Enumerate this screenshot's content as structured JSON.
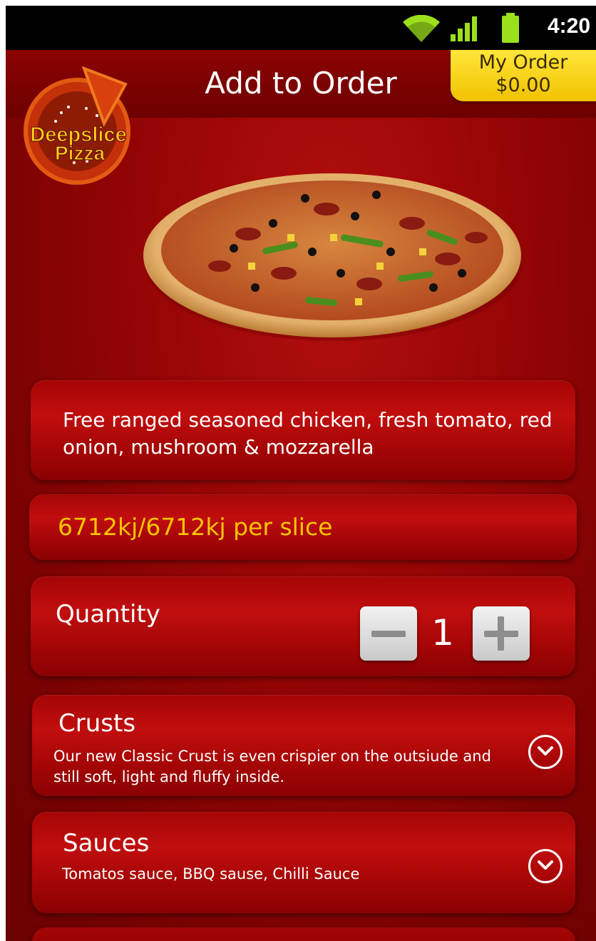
{
  "status_bar": {
    "time": "4:20",
    "icons": [
      "wifi-icon",
      "signal-icon",
      "battery-icon"
    ]
  },
  "header": {
    "title": "Add to Order",
    "my_order_label": "My Order",
    "my_order_total": "$0.00"
  },
  "logo": {
    "line1": "Deepslice",
    "line2": "Pizza"
  },
  "product": {
    "description": "Free ranged seasoned chicken, fresh tomato, red onion, mushroom & mozzarella",
    "energy": "6712kj/6712kj per slice"
  },
  "quantity": {
    "label": "Quantity",
    "value": "1"
  },
  "crusts": {
    "title": "Crusts",
    "description": "Our new Classic Crust is even crispier on the outsiude and still soft, light and fluffy inside."
  },
  "sauces": {
    "title": "Sauces",
    "description": "Tomatos sauce, BBQ sause, Chilli Sauce"
  },
  "colors": {
    "background": "#960505",
    "accent_yellow": "#ffc400",
    "order_badge": "#ffe63a"
  }
}
